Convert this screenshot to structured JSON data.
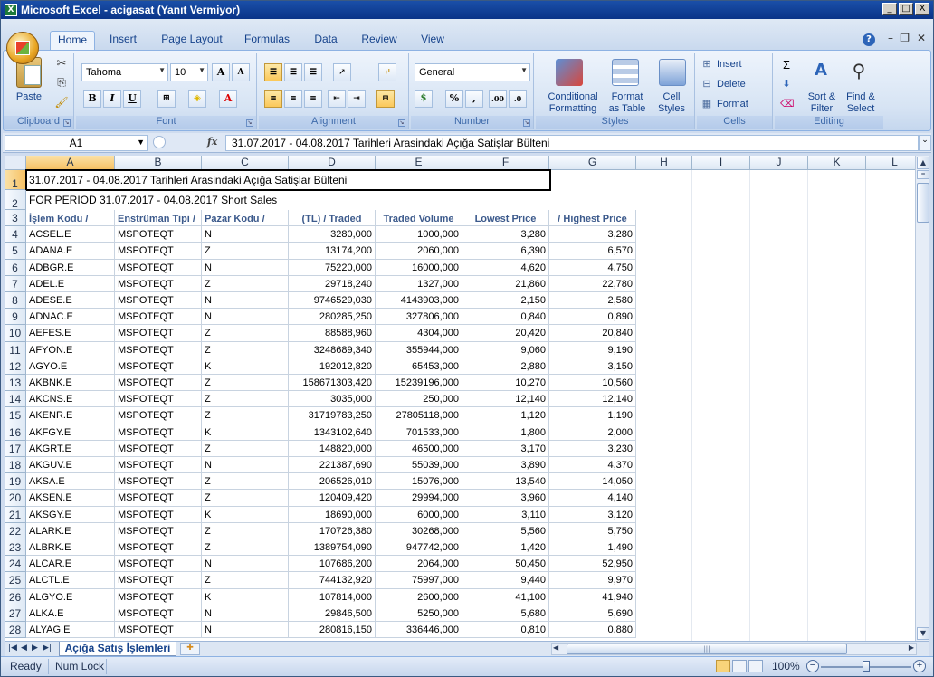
{
  "window": {
    "title": "Microsoft Excel - acigasat (Yanıt Vermiyor)",
    "min": "_",
    "max": "□",
    "close": "X"
  },
  "ribbon": {
    "tabs": [
      "Home",
      "Insert",
      "Page Layout",
      "Formulas",
      "Data",
      "Review",
      "View"
    ],
    "clipboard": {
      "paste": "Paste",
      "label": "Clipboard"
    },
    "font": {
      "name": "Tahoma",
      "size": "10",
      "label": "Font",
      "bold": "B",
      "italic": "I",
      "underline": "U",
      "grow": "A",
      "shrink": "A"
    },
    "alignment": {
      "label": "Alignment"
    },
    "number": {
      "format": "General",
      "label": "Number",
      "percent": "%",
      "comma": ",",
      "inc": ".00",
      "dec": ".0"
    },
    "styles": {
      "label": "Styles",
      "conditional": "Conditional\nFormatting",
      "format_table": "Format\nas Table",
      "cell_styles": "Cell\nStyles"
    },
    "cells": {
      "label": "Cells",
      "insert": "Insert",
      "delete": "Delete",
      "format": "Format"
    },
    "editing": {
      "label": "Editing",
      "sort": "Sort &\nFilter",
      "find": "Find &\nSelect",
      "sigma": "Σ"
    }
  },
  "formula_bar": {
    "name_box": "A1",
    "fx": "fx",
    "formula": "31.07.2017 - 04.08.2017 Tarihleri Arasindaki Açığa Satişlar Bülteni"
  },
  "columns": [
    "A",
    "B",
    "C",
    "D",
    "E",
    "F",
    "G",
    "H",
    "I",
    "J",
    "K",
    "L"
  ],
  "sheet": {
    "title_row": "31.07.2017 - 04.08.2017 Tarihleri Arasindaki Açığa Satişlar Bülteni",
    "subtitle_row": "FOR PERIOD 31.07.2017 - 04.08.2017 Short Sales",
    "headers": [
      "İşlem Kodu /",
      "Enstrüman Tipi /",
      "Pazar Kodu /",
      "(TL) / Traded",
      "Traded Volume",
      "Lowest Price",
      "/ Highest Price"
    ],
    "rows": [
      [
        "ACSEL.E",
        "MSPOTEQT",
        "N",
        "3280,000",
        "1000,000",
        "3,280",
        "3,280"
      ],
      [
        "ADANA.E",
        "MSPOTEQT",
        "Z",
        "13174,200",
        "2060,000",
        "6,390",
        "6,570"
      ],
      [
        "ADBGR.E",
        "MSPOTEQT",
        "N",
        "75220,000",
        "16000,000",
        "4,620",
        "4,750"
      ],
      [
        "ADEL.E",
        "MSPOTEQT",
        "Z",
        "29718,240",
        "1327,000",
        "21,860",
        "22,780"
      ],
      [
        "ADESE.E",
        "MSPOTEQT",
        "N",
        "9746529,030",
        "4143903,000",
        "2,150",
        "2,580"
      ],
      [
        "ADNAC.E",
        "MSPOTEQT",
        "N",
        "280285,250",
        "327806,000",
        "0,840",
        "0,890"
      ],
      [
        "AEFES.E",
        "MSPOTEQT",
        "Z",
        "88588,960",
        "4304,000",
        "20,420",
        "20,840"
      ],
      [
        "AFYON.E",
        "MSPOTEQT",
        "Z",
        "3248689,340",
        "355944,000",
        "9,060",
        "9,190"
      ],
      [
        "AGYO.E",
        "MSPOTEQT",
        "K",
        "192012,820",
        "65453,000",
        "2,880",
        "3,150"
      ],
      [
        "AKBNK.E",
        "MSPOTEQT",
        "Z",
        "158671303,420",
        "15239196,000",
        "10,270",
        "10,560"
      ],
      [
        "AKCNS.E",
        "MSPOTEQT",
        "Z",
        "3035,000",
        "250,000",
        "12,140",
        "12,140"
      ],
      [
        "AKENR.E",
        "MSPOTEQT",
        "Z",
        "31719783,250",
        "27805118,000",
        "1,120",
        "1,190"
      ],
      [
        "AKFGY.E",
        "MSPOTEQT",
        "K",
        "1343102,640",
        "701533,000",
        "1,800",
        "2,000"
      ],
      [
        "AKGRT.E",
        "MSPOTEQT",
        "Z",
        "148820,000",
        "46500,000",
        "3,170",
        "3,230"
      ],
      [
        "AKGUV.E",
        "MSPOTEQT",
        "N",
        "221387,690",
        "55039,000",
        "3,890",
        "4,370"
      ],
      [
        "AKSA.E",
        "MSPOTEQT",
        "Z",
        "206526,010",
        "15076,000",
        "13,540",
        "14,050"
      ],
      [
        "AKSEN.E",
        "MSPOTEQT",
        "Z",
        "120409,420",
        "29994,000",
        "3,960",
        "4,140"
      ],
      [
        "AKSGY.E",
        "MSPOTEQT",
        "K",
        "18690,000",
        "6000,000",
        "3,110",
        "3,120"
      ],
      [
        "ALARK.E",
        "MSPOTEQT",
        "Z",
        "170726,380",
        "30268,000",
        "5,560",
        "5,750"
      ],
      [
        "ALBRK.E",
        "MSPOTEQT",
        "Z",
        "1389754,090",
        "947742,000",
        "1,420",
        "1,490"
      ],
      [
        "ALCAR.E",
        "MSPOTEQT",
        "N",
        "107686,200",
        "2064,000",
        "50,450",
        "52,950"
      ],
      [
        "ALCTL.E",
        "MSPOTEQT",
        "Z",
        "744132,920",
        "75997,000",
        "9,440",
        "9,970"
      ],
      [
        "ALGYO.E",
        "MSPOTEQT",
        "K",
        "107814,000",
        "2600,000",
        "41,100",
        "41,940"
      ],
      [
        "ALKA.E",
        "MSPOTEQT",
        "N",
        "29846,500",
        "5250,000",
        "5,680",
        "5,690"
      ],
      [
        "ALYAG.E",
        "MSPOTEQT",
        "N",
        "280816,150",
        "336446,000",
        "0,810",
        "0,880"
      ]
    ],
    "tab_name": "Açığa Satış İşlemleri"
  },
  "status": {
    "ready": "Ready",
    "numlock": "Num Lock",
    "zoom": "100%"
  }
}
